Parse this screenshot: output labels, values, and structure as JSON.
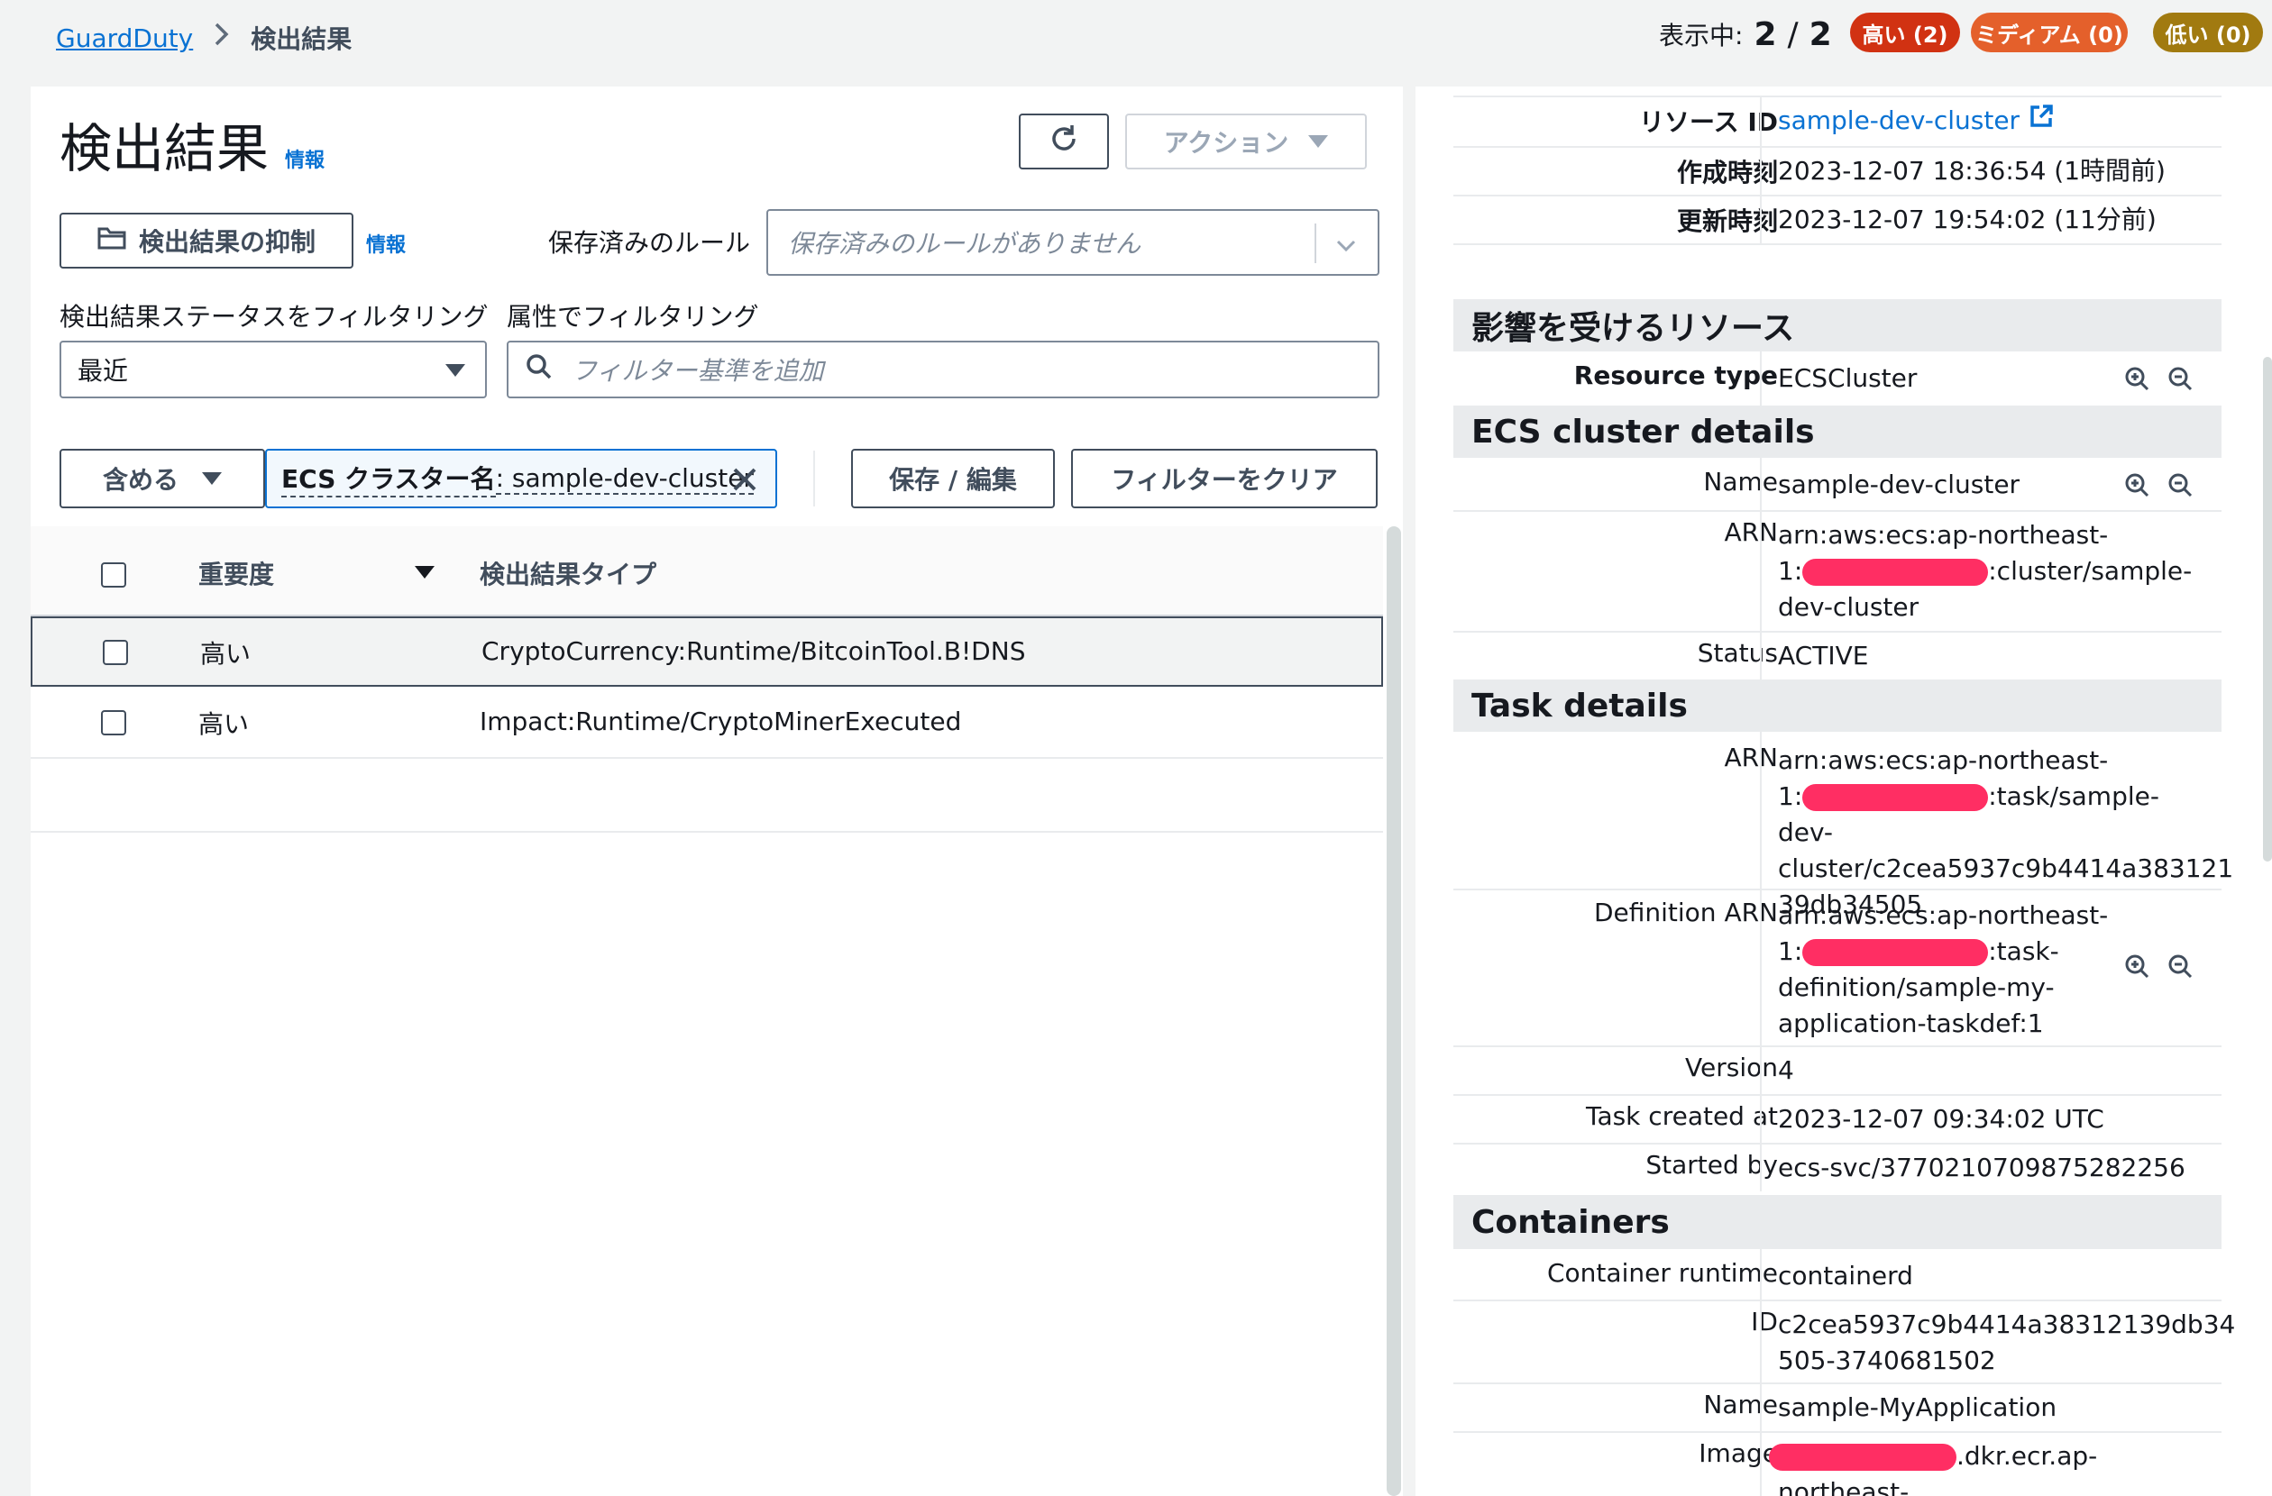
{
  "breadcrumb": {
    "root": "GuardDuty",
    "current": "検出結果"
  },
  "counter": {
    "label": "表示中:",
    "shown": "2",
    "sep": "/",
    "total": "2"
  },
  "severity_pills": [
    {
      "label": "高い (2)",
      "color": "#d13212"
    },
    {
      "label": "ミディアム (0)",
      "color": "#e4602b"
    },
    {
      "label": "低い (0)",
      "color": "#a17a10"
    }
  ],
  "main": {
    "title": "検出結果",
    "info": "情報",
    "actions_label": "アクション",
    "suppress_label": "検出結果の抑制",
    "suppress_info": "情報",
    "saved_rules_label": "保存済みのルール",
    "saved_rules_placeholder": "保存済みのルールがありません",
    "status_filter_label": "検出結果ステータスをフィルタリング",
    "status_filter_value": "最近",
    "attr_filter_label": "属性でフィルタリング",
    "attr_filter_placeholder": "フィルター基準を追加",
    "include_label": "含める",
    "token_key": "ECS クラスター名",
    "token_value": ": sample-dev-cluster",
    "save_edit_label": "保存 / 編集",
    "clear_filter_label": "フィルターをクリア"
  },
  "table": {
    "col_severity": "重要度",
    "col_type": "検出結果タイプ",
    "rows": [
      {
        "severity": "高い",
        "type": "CryptoCurrency:Runtime/BitcoinTool.B!DNS"
      },
      {
        "severity": "高い",
        "type": "Impact:Runtime/CryptoMinerExecuted"
      }
    ]
  },
  "detail": {
    "top": [
      {
        "key": "リソース ID",
        "value": "sample-dev-cluster"
      },
      {
        "key": "作成時刻",
        "value": "2023-12-07 18:36:54 (1時間前)"
      },
      {
        "key": "更新時刻",
        "value": "2023-12-07 19:54:02 (11分前)"
      }
    ],
    "affected_title": "影響を受けるリソース",
    "resource_type_key": "Resource type",
    "resource_type_value": "ECSCluster",
    "ecs_title": "ECS cluster details",
    "ecs": {
      "name_key": "Name",
      "name_value": "sample-dev-cluster",
      "arn_key": "ARN",
      "arn_line1": "arn:aws:ecs:ap-northeast-",
      "arn_line2_pre": "1:",
      "arn_line2_post": ":cluster/sample-",
      "arn_line3": "dev-cluster",
      "status_key": "Status",
      "status_value": "ACTIVE"
    },
    "task_title": "Task details",
    "task": {
      "arn_key": "ARN",
      "arn_line1": "arn:aws:ecs:ap-northeast-",
      "arn_line2_pre": "1:",
      "arn_line2_post": ":task/sample-dev-",
      "arn_line3": "cluster/c2cea5937c9b4414a383121",
      "arn_line4": "39db34505",
      "def_key": "Definition ARN",
      "def_line1": "arn:aws:ecs:ap-northeast-",
      "def_line2_pre": "1:",
      "def_line2_post": ":task-",
      "def_line3": "definition/sample-my-",
      "def_line4": "application-taskdef:1",
      "version_key": "Version",
      "version_value": "4",
      "created_key": "Task created at",
      "created_value": "2023-12-07 09:34:02 UTC",
      "started_key": "Started by",
      "started_value": "ecs-svc/3770210709875282256"
    },
    "containers_title": "Containers",
    "containers": {
      "runtime_key": "Container runtime",
      "runtime_value": "containerd",
      "id_key": "ID",
      "id_line1": "c2cea5937c9b4414a38312139db34",
      "id_line2": "505-3740681502",
      "name_key": "Name",
      "name_value": "sample-MyApplication",
      "image_key": "Image",
      "image_line1_post": ".dkr.ecr.ap-",
      "image_line2": "northeast-"
    }
  },
  "colors": {
    "link": "#0972d3",
    "redaction": "#ff2e63"
  }
}
